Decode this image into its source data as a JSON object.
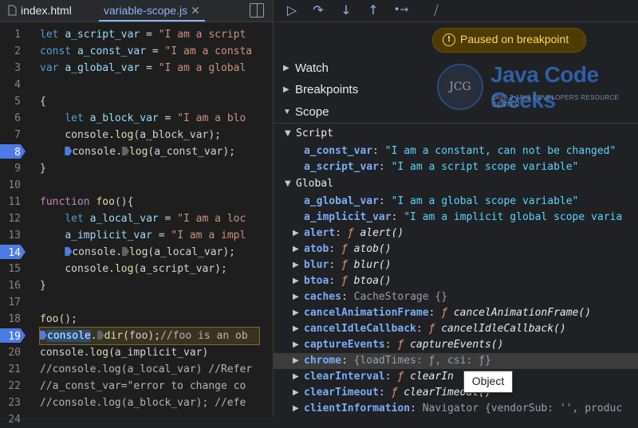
{
  "tabs": [
    {
      "label": "index.html"
    },
    {
      "label": "variable-scope.js",
      "close": "✕"
    }
  ],
  "editor": {
    "lines": [
      {
        "n": "1"
      },
      {
        "n": "2"
      },
      {
        "n": "3"
      },
      {
        "n": "4"
      },
      {
        "n": "5"
      },
      {
        "n": "6"
      },
      {
        "n": "7"
      },
      {
        "n": "8"
      },
      {
        "n": "9"
      },
      {
        "n": "10"
      },
      {
        "n": "11"
      },
      {
        "n": "12"
      },
      {
        "n": "13"
      },
      {
        "n": "14"
      },
      {
        "n": "15"
      },
      {
        "n": "16"
      },
      {
        "n": "17"
      },
      {
        "n": "18"
      },
      {
        "n": "19"
      },
      {
        "n": "20"
      },
      {
        "n": "21"
      },
      {
        "n": "22"
      },
      {
        "n": "23"
      },
      {
        "n": "24"
      }
    ],
    "code": {
      "l1": {
        "kw": "let",
        "v": "a_script_var",
        "eq": " = ",
        "s": "\"I am a script"
      },
      "l2": {
        "kw": "const",
        "v": "a_const_var",
        "eq": " = ",
        "s": "\"I am a consta"
      },
      "l3": {
        "kw": "var",
        "v": "a_global_var",
        "eq": " = ",
        "s": "\"I am a global"
      },
      "l5": "{",
      "l6": {
        "kw": "let",
        "v": "a_block_var",
        "eq": " = ",
        "s": "\"I am a blo"
      },
      "l7": {
        "o": "console.",
        "f": "log",
        "a": "(a_block_var);"
      },
      "l8": {
        "o": "console.",
        "f": "log",
        "a": "(a_const_var);"
      },
      "l9": "}",
      "l11": {
        "kw": "function",
        "f": "foo",
        "a": "(){"
      },
      "l12": {
        "kw": "let",
        "v": "a_local_var",
        "eq": " = ",
        "s": "\"I am a loc"
      },
      "l13": {
        "v": "a_implicit_var",
        "eq": " = ",
        "s": "\"I am a impl"
      },
      "l14": {
        "o": "console.",
        "f": "log",
        "a": "(a_local_var);"
      },
      "l15": {
        "o": "console.",
        "f": "log",
        "a": "(a_script_var);"
      },
      "l16": "}",
      "l18": {
        "f": "foo",
        "a": "();"
      },
      "l19": {
        "o": "console",
        "dot": ".",
        "f": "dir",
        "a": "(foo);",
        "c": "//foo is an ob"
      },
      "l20": {
        "o": "console.",
        "f": "log",
        "a": "(a_implicit_var)"
      },
      "l21": "//console.log(a_local_var) //Refer",
      "l22": "//a_const_var=\"error to change co",
      "l23": "//console.log(a_block_var); //efe"
    }
  },
  "toolbar": {
    "resume": "▷",
    "step_over": "↷",
    "step_into": "↓",
    "step_out": "↑",
    "step": "•→",
    "deactivate": "⧸"
  },
  "banner": {
    "icon": "!",
    "text": "Paused on breakpoint"
  },
  "sections": {
    "watch": "Watch",
    "breakpoints": "Breakpoints",
    "scope": "Scope"
  },
  "logo": {
    "initials": "JCG",
    "name": "Java Code Geeks",
    "tagline": "JAVA 2 JAVA DEVELOPERS RESOURCE CENTER"
  },
  "scope": {
    "script_header": "Script",
    "script_vars": [
      {
        "name": "a_const_var",
        "value": "\"I am a constant, can not be changed\""
      },
      {
        "name": "a_script_var",
        "value": "\"I am a script scope variable\""
      }
    ],
    "global_header": "Global",
    "global_vars": [
      {
        "name": "a_global_var",
        "value": "\"I am a global scope variable\""
      },
      {
        "name": "a_implicit_var",
        "value": "\"I am a implicit global scope varia"
      }
    ],
    "props": [
      {
        "name": "alert",
        "f": "ƒ",
        "val": "alert()"
      },
      {
        "name": "atob",
        "f": "ƒ",
        "val": "atob()"
      },
      {
        "name": "blur",
        "f": "ƒ",
        "val": "blur()"
      },
      {
        "name": "btoa",
        "f": "ƒ",
        "val": "btoa()"
      },
      {
        "name": "caches",
        "val": "CacheStorage {}"
      },
      {
        "name": "cancelAnimationFrame",
        "f": "ƒ",
        "val": "cancelAnimationFrame()"
      },
      {
        "name": "cancelIdleCallback",
        "f": "ƒ",
        "val": "cancelIdleCallback()"
      },
      {
        "name": "captureEvents",
        "f": "ƒ",
        "val": "captureEvents()"
      },
      {
        "name": "chrome",
        "val": "{loadTimes: ƒ, csi: ƒ}"
      },
      {
        "name": "clearInterval",
        "f": "ƒ",
        "val": "clearIn"
      },
      {
        "name": "clearTimeout",
        "f": "ƒ",
        "val": "clearTimeout()"
      },
      {
        "name": "clientInformation",
        "val": "Navigator {vendorSub: '', produc"
      }
    ]
  },
  "tooltip": "Object"
}
